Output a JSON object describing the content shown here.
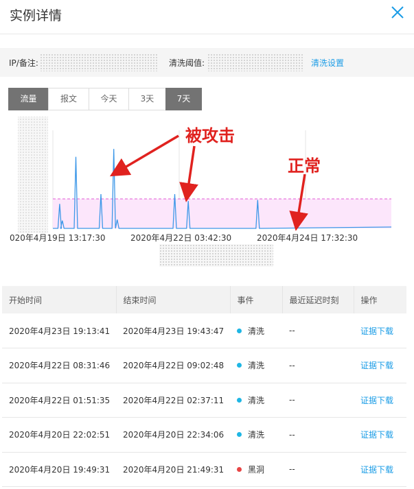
{
  "header": {
    "title": "实例详情",
    "close_icon": "close-icon"
  },
  "info": {
    "ip_label": "IP/备注:",
    "threshold_label": "清洗阈值:",
    "settings_link": "清洗设置"
  },
  "tabs": [
    "流量",
    "报文",
    "今天",
    "3天",
    "7天"
  ],
  "chart_data": {
    "type": "line",
    "x_tick_labels": [
      "020年4月19日 13:17:30",
      "2020年4月22日 03:42:30",
      "2020年4月24日 17:32:30"
    ],
    "annotations": [
      "被攻击",
      "正常"
    ],
    "colors": {
      "line": "#3d98e8",
      "threshold": "#e25bd6",
      "threshold_fill": "#fce6fb",
      "annotation": "#e0221f"
    },
    "threshold_level": 0.27,
    "series": [
      {
        "peaks": [
          {
            "t": 0.02,
            "v": 0.25
          },
          {
            "t": 0.028,
            "v": 0.08
          },
          {
            "t": 0.068,
            "v": 0.73
          },
          {
            "t": 0.142,
            "v": 0.35
          },
          {
            "t": 0.18,
            "v": 0.81
          },
          {
            "t": 0.19,
            "v": 0.09
          },
          {
            "t": 0.36,
            "v": 0.35
          },
          {
            "t": 0.4,
            "v": 0.28
          },
          {
            "t": 0.605,
            "v": 0.29
          }
        ]
      }
    ]
  },
  "table": {
    "headers": [
      "开始时间",
      "结束时间",
      "事件",
      "最近延迟时刻",
      "操作"
    ],
    "rows": [
      {
        "start": "2020年4月23日 19:13:41",
        "end": "2020年4月23日 19:43:47",
        "event": "清洗",
        "event_color": "#1fb6e4",
        "delay": "--",
        "action": "证据下载"
      },
      {
        "start": "2020年4月22日 08:31:46",
        "end": "2020年4月22日 09:02:48",
        "event": "清洗",
        "event_color": "#1fb6e4",
        "delay": "--",
        "action": "证据下载"
      },
      {
        "start": "2020年4月22日 01:51:35",
        "end": "2020年4月22日 02:37:11",
        "event": "清洗",
        "event_color": "#1fb6e4",
        "delay": "--",
        "action": "证据下载"
      },
      {
        "start": "2020年4月20日 22:02:51",
        "end": "2020年4月20日 22:34:06",
        "event": "清洗",
        "event_color": "#1fb6e4",
        "delay": "--",
        "action": "证据下载"
      },
      {
        "start": "2020年4月20日 19:49:31",
        "end": "2020年4月20日 21:49:31",
        "event": "黑洞",
        "event_color": "#e84545",
        "delay": "--",
        "action": "证据下载"
      }
    ]
  }
}
